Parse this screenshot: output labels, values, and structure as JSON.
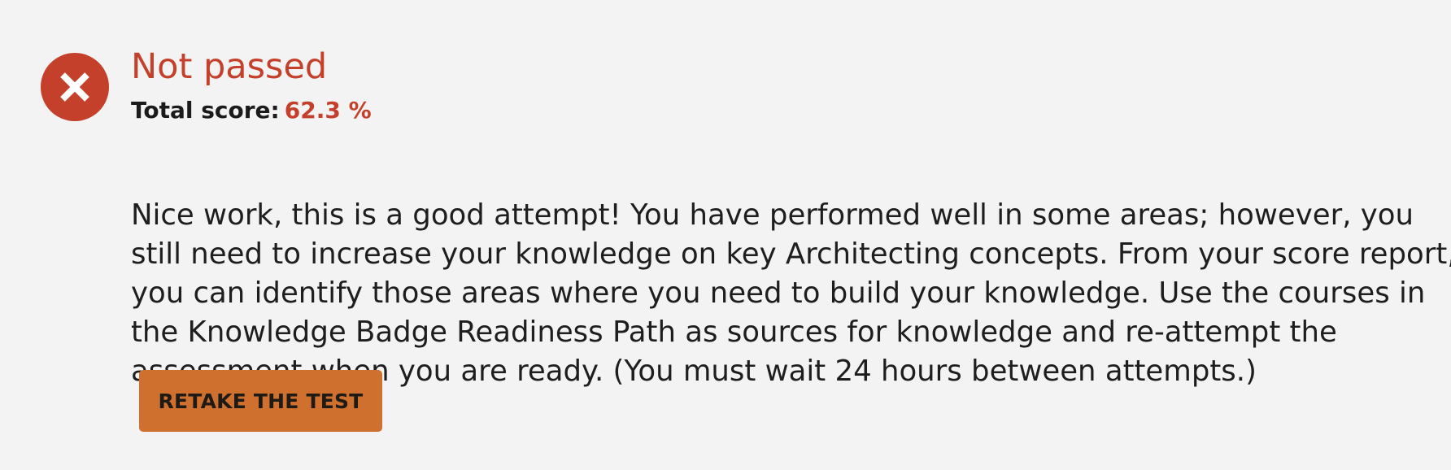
{
  "result": {
    "title": "Not passed",
    "score_label": "Total score:",
    "score_value": "62.3 %",
    "icon": "x-circle-icon"
  },
  "message": {
    "lines": [
      "Nice work, this is a good attempt! You have performed well in some areas; however, you",
      "still need to increase your knowledge on key Architecting concepts. From your score report,",
      "you can identify those areas where you need to build your knowledge. Use the courses in",
      "the Knowledge Badge Readiness Path as sources for knowledge and re-attempt the",
      "assessment when you are ready. (You must wait 24 hours between attempts.)"
    ]
  },
  "actions": {
    "retake_label": "RETAKE THE TEST"
  },
  "colors": {
    "background": "#f2f3f2",
    "fail": "#c4402b",
    "button": "#d0702e"
  }
}
